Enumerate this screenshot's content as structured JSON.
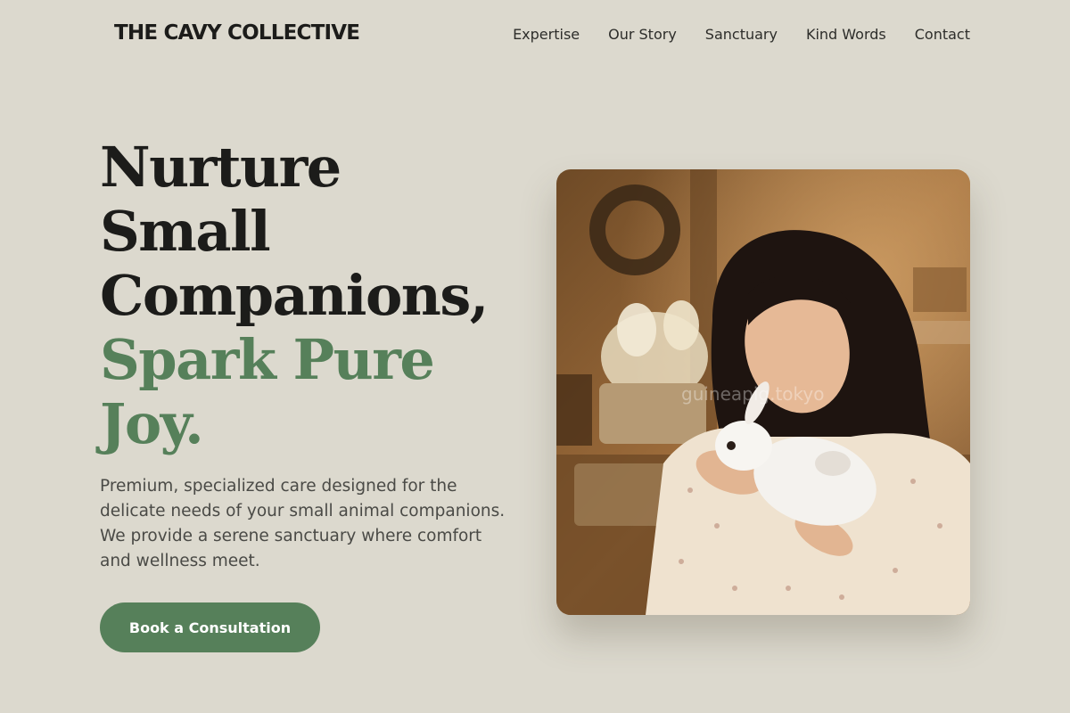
{
  "header": {
    "logo": "THE CAVY COLLECTIVE",
    "nav": [
      "Expertise",
      "Our Story",
      "Sanctuary",
      "Kind Words",
      "Contact"
    ]
  },
  "hero": {
    "title_lines": [
      "Nurture",
      "Small",
      "Companions,"
    ],
    "accent_lines": [
      "Spark Pure",
      "Joy."
    ],
    "description": "Premium, specialized care designed for the delicate needs of your small animal companions. We provide a serene sanctuary where comfort and wellness meet.",
    "cta_label": "Book a Consultation",
    "image_watermark": "guineapig.tokyo"
  },
  "colors": {
    "background": "#dcd9ce",
    "accent": "#56805a",
    "text": "#1c1c1a"
  }
}
